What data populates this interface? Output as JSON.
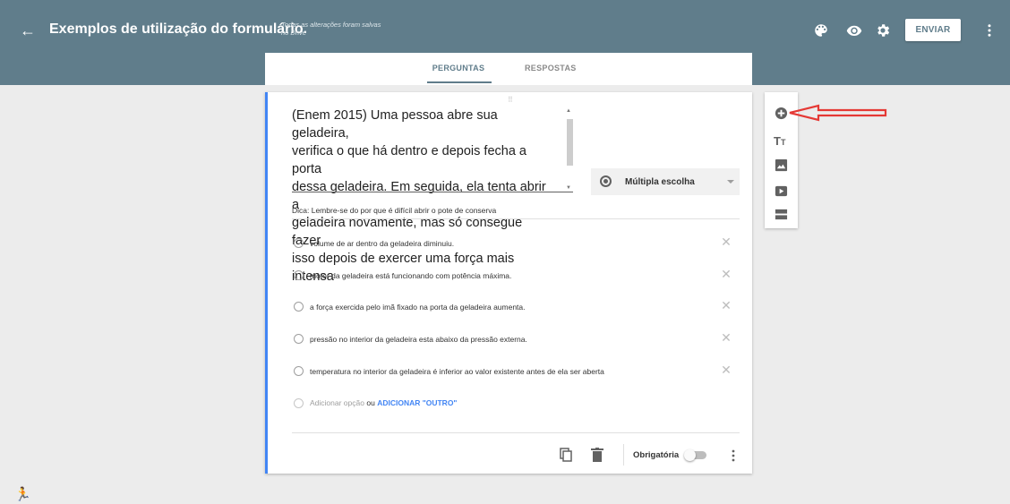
{
  "header": {
    "back_icon": "arrow-left-icon",
    "title": "Exemplos de utilização do formulário.",
    "save_status": "Todas as alterações foram salvas no Drive",
    "icons": [
      "palette-icon",
      "eye-icon",
      "gear-icon",
      "more-vert-icon"
    ],
    "send_label": "ENVIAR",
    "color": "#607d8b"
  },
  "tabs": [
    {
      "label": "PERGUNTAS",
      "active": true
    },
    {
      "label": "RESPOSTAS",
      "active": false
    }
  ],
  "question": {
    "text": "(Enem 2015) Uma pessoa abre sua geladeira,\nverifica o que há dentro e depois fecha a porta\ndessa geladeira. Em seguida, ela tenta abrir a\ngeladeira novamente, mas só consegue fazer\nisso depois de exercer uma força mais intensa",
    "type": "Múltipla escolha",
    "hint": "Dica: Lembre-se do por que é difícil abrir o pote de conserva",
    "options": [
      {
        "label": "volume de ar dentro da geladeira diminuiu."
      },
      {
        "label": "motor da geladeira está funcionando com potência máxima."
      },
      {
        "label": "a força exercida pelo imã fixado na porta da geladeira aumenta."
      },
      {
        "label": "pressão no interior da geladeira esta abaixo da pressão externa."
      },
      {
        "label": "temperatura no interior da geladeira é inferior ao valor existente antes de ela ser aberta"
      }
    ],
    "add_option": "Adicionar opção",
    "or": "ou",
    "add_other": "ADICIONAR \"OUTRO\"",
    "required_label": "Obrigatória",
    "required": false,
    "accent_color": "#4285f4"
  },
  "side_toolbar": {
    "icons": [
      "add-circle-icon",
      "title-text-icon",
      "image-icon",
      "video-icon",
      "section-icon"
    ],
    "tt_big": "T",
    "tt_small": "T"
  },
  "annotation": {
    "arrow_color": "#e53935"
  }
}
